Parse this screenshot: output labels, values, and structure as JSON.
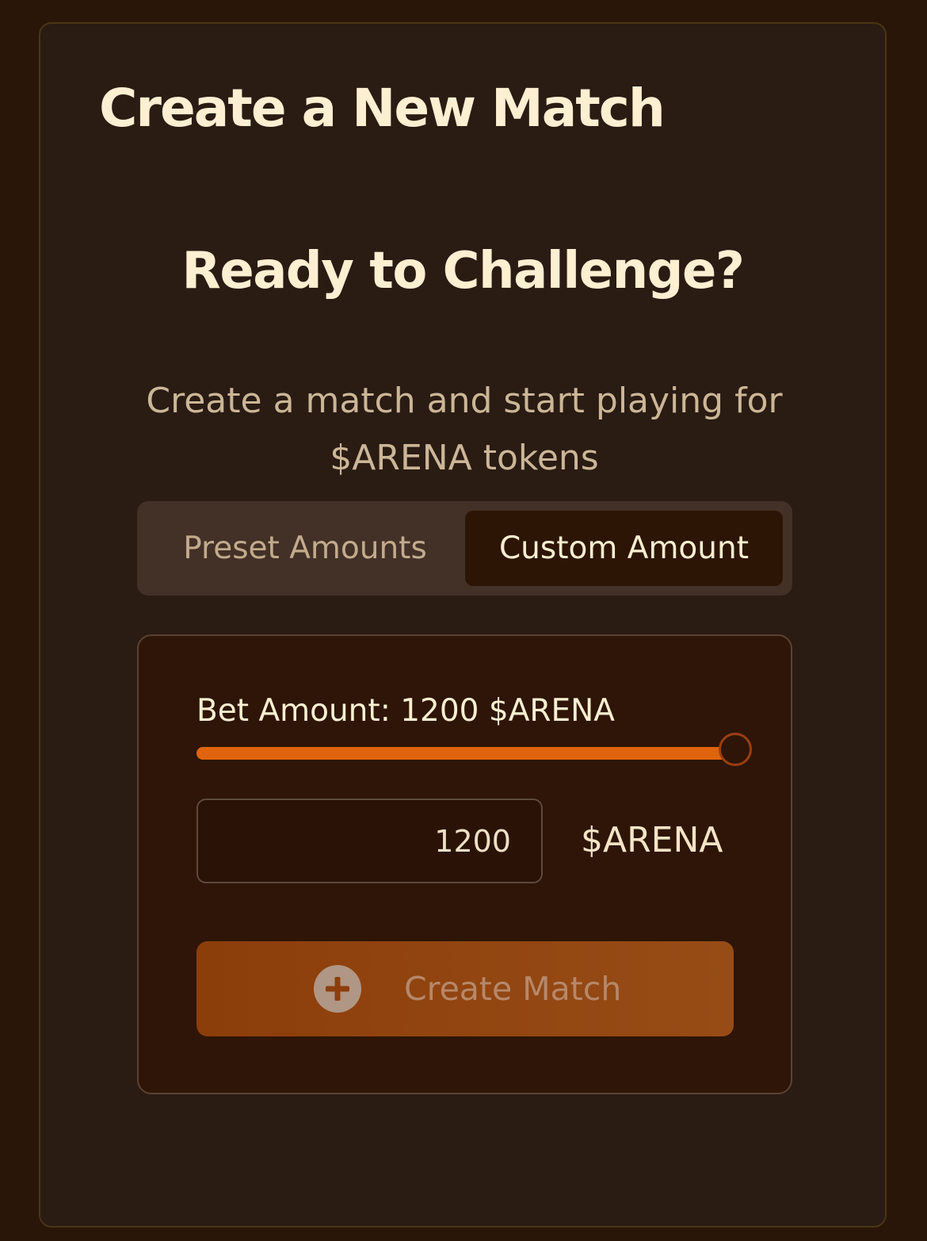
{
  "card": {
    "title": "Create a New Match"
  },
  "hero": {
    "headline": "Ready to Challenge?",
    "subtitle": "Create a match and start playing for $ARENA tokens"
  },
  "tabs": [
    {
      "label": "Preset Amounts",
      "active": false
    },
    {
      "label": "Custom Amount",
      "active": true
    }
  ],
  "bet": {
    "label_prefix": "Bet Amount: 1200 $ARENA",
    "slider_value_fraction": 1.0,
    "input_value": "1200",
    "unit": "$ARENA"
  },
  "actions": {
    "create_label": "Create Match",
    "create_icon": "plus-circle-icon"
  },
  "colors": {
    "page_bg": "#2a1609",
    "card_bg": "#2a1b13",
    "accent": "#e0640e",
    "text_primary": "#fdefd1",
    "text_secondary": "#cbb697",
    "button_bg": "#8c3e0a"
  }
}
